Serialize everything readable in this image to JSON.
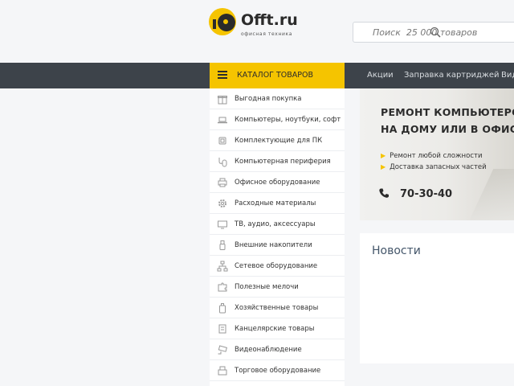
{
  "logo": {
    "title": "Offt.ru",
    "subtitle": "офисная техника"
  },
  "search": {
    "placeholder": "Поиск  25 000 товаров"
  },
  "catalog": {
    "label": "КАТАЛОГ ТОВАРОВ"
  },
  "nav": {
    "links": [
      "Акции",
      "Заправка картриджей",
      "Вид"
    ]
  },
  "menu": {
    "items": [
      {
        "label": "Выгодная покупка",
        "icon": "gift-icon"
      },
      {
        "label": "Компьютеры, ноутбуки, софт",
        "icon": "laptop-icon"
      },
      {
        "label": "Комплектующие для ПК",
        "icon": "cpu-icon"
      },
      {
        "label": "Компьютерная периферия",
        "icon": "mouse-icon"
      },
      {
        "label": "Офисное оборудование",
        "icon": "printer-icon"
      },
      {
        "label": "Расходные материалы",
        "icon": "gear-icon"
      },
      {
        "label": "ТВ, аудио, аксессуары",
        "icon": "tv-icon"
      },
      {
        "label": "Внешние накопители",
        "icon": "usb-icon"
      },
      {
        "label": "Сетевое оборудование",
        "icon": "network-icon"
      },
      {
        "label": "Полезные мелочи",
        "icon": "puzzle-icon"
      },
      {
        "label": "Хозяйственные товары",
        "icon": "bottle-icon"
      },
      {
        "label": "Канцелярские товары",
        "icon": "notepad-icon"
      },
      {
        "label": "Видеонаблюдение",
        "icon": "camera-icon"
      },
      {
        "label": "Торговое оборудование",
        "icon": "register-icon"
      }
    ]
  },
  "banner": {
    "title_line1": "РЕМОНТ КОМПЬЮТЕРОВ",
    "title_line2": "НА ДОМУ ИЛИ В ОФИСЕ",
    "bullet1": "Ремонт любой сложности",
    "bullet2": "Доставка запасных частей",
    "phone": "70-30-40"
  },
  "news": {
    "title": "Новости"
  },
  "colors": {
    "accent": "#f5c400",
    "navbar": "#3d434a",
    "background": "#f5f6f8"
  }
}
